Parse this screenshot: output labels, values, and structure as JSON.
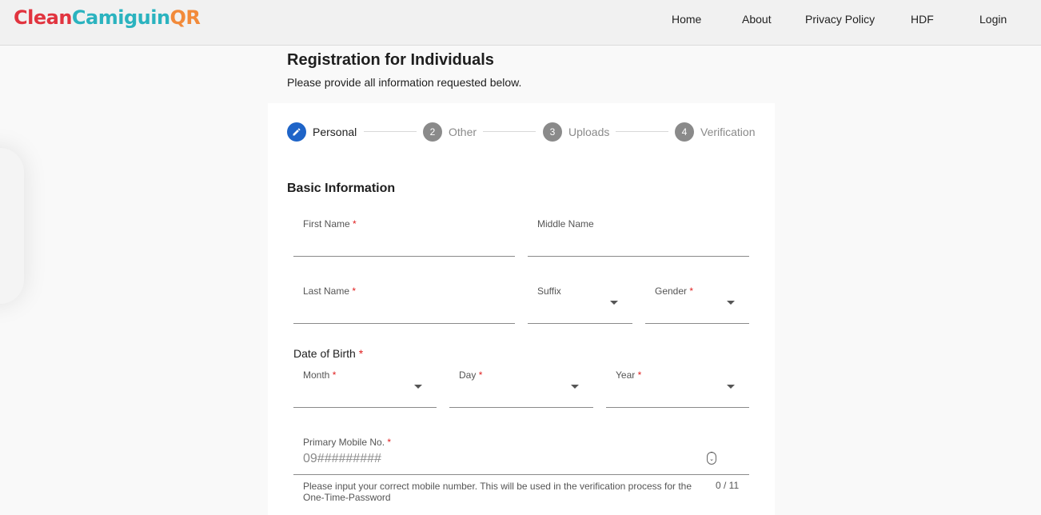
{
  "header": {
    "logo": {
      "part1": "Clean",
      "part2": "Camiguin",
      "part3": "QR"
    },
    "nav": [
      {
        "label": "Home"
      },
      {
        "label": "About"
      },
      {
        "label": "Privacy Policy"
      },
      {
        "label": "HDF"
      },
      {
        "label": "Login"
      }
    ]
  },
  "page": {
    "title": "Registration for Individuals",
    "subtitle": "Please provide all information requested below."
  },
  "stepper": {
    "steps": [
      {
        "number": "",
        "icon": "pencil-icon",
        "label": "Personal",
        "active": true
      },
      {
        "number": "2",
        "label": "Other",
        "active": false
      },
      {
        "number": "3",
        "label": "Uploads",
        "active": false
      },
      {
        "number": "4",
        "label": "Verification",
        "active": false
      }
    ]
  },
  "form": {
    "section_title": "Basic Information",
    "required_mark": "*",
    "first_name": {
      "label": "First Name",
      "value": ""
    },
    "middle_name": {
      "label": "Middle Name",
      "value": ""
    },
    "last_name": {
      "label": "Last Name",
      "value": ""
    },
    "suffix": {
      "label": "Suffix",
      "value": ""
    },
    "gender": {
      "label": "Gender",
      "value": ""
    },
    "dob": {
      "label": "Date of Birth",
      "month": {
        "label": "Month",
        "value": ""
      },
      "day": {
        "label": "Day",
        "value": ""
      },
      "year": {
        "label": "Year",
        "value": ""
      }
    },
    "mobile": {
      "label": "Primary Mobile No.",
      "placeholder": "09#########",
      "value": "",
      "hint": "Please input your correct mobile number. This will be used in the verification process for the One-Time-Password",
      "counter": "0 / 11"
    }
  }
}
